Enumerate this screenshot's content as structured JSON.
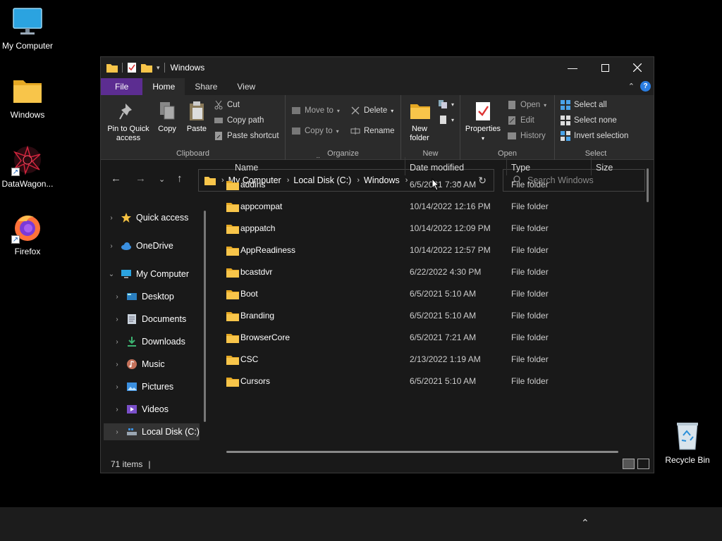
{
  "desktop": {
    "icons": [
      {
        "label": "My Computer",
        "icon": "monitor-icon"
      },
      {
        "label": "Windows",
        "icon": "folder-icon"
      },
      {
        "label": "DataWagon...",
        "icon": "datawagon-app-icon"
      },
      {
        "label": "Firefox",
        "icon": "firefox-icon"
      },
      {
        "label": "Recycle Bin",
        "icon": "recycle-bin-icon"
      }
    ]
  },
  "window": {
    "title": "Windows",
    "tabs": [
      "File",
      "Home",
      "Share",
      "View"
    ],
    "active_tab": "Home"
  },
  "ribbon": {
    "clipboard": {
      "label": "Clipboard",
      "pin": "Pin to Quick\naccess",
      "copy": "Copy",
      "paste": "Paste",
      "cut": "Cut",
      "copy_path": "Copy path",
      "paste_shortcut": "Paste shortcut"
    },
    "organize": {
      "label": "Organize",
      "move_to": "Move to",
      "copy_to": "Copy to",
      "delete": "Delete",
      "rename": "Rename"
    },
    "new": {
      "label": "New",
      "new_folder": "New\nfolder"
    },
    "open": {
      "label": "Open",
      "properties": "Properties",
      "open": "Open",
      "edit": "Edit",
      "history": "History"
    },
    "select": {
      "label": "Select",
      "select_all": "Select all",
      "select_none": "Select none",
      "invert": "Invert selection"
    }
  },
  "address": {
    "crumbs": [
      "My Computer",
      "Local Disk (C:)",
      "Windows"
    ],
    "search_placeholder": "Search Windows"
  },
  "nav": {
    "items": [
      {
        "label": "Quick access",
        "icon": "star-icon"
      },
      {
        "label": "OneDrive",
        "icon": "cloud-icon"
      },
      {
        "label": "My Computer",
        "icon": "monitor-icon"
      },
      {
        "label": "Desktop",
        "icon": "desktop-icon"
      },
      {
        "label": "Documents",
        "icon": "documents-icon"
      },
      {
        "label": "Downloads",
        "icon": "download-icon"
      },
      {
        "label": "Music",
        "icon": "music-icon"
      },
      {
        "label": "Pictures",
        "icon": "pictures-icon"
      },
      {
        "label": "Videos",
        "icon": "videos-icon"
      },
      {
        "label": "Local Disk (C:)",
        "icon": "disk-icon"
      }
    ]
  },
  "files": {
    "columns": [
      "Name",
      "Date modified",
      "Type",
      "Size"
    ],
    "rows": [
      {
        "name": "addins",
        "date": "6/5/2021 7:30 AM",
        "type": "File folder"
      },
      {
        "name": "appcompat",
        "date": "10/14/2022 12:16 PM",
        "type": "File folder"
      },
      {
        "name": "apppatch",
        "date": "10/14/2022 12:09 PM",
        "type": "File folder"
      },
      {
        "name": "AppReadiness",
        "date": "10/14/2022 12:57 PM",
        "type": "File folder"
      },
      {
        "name": "bcastdvr",
        "date": "6/22/2022 4:30 PM",
        "type": "File folder"
      },
      {
        "name": "Boot",
        "date": "6/5/2021 5:10 AM",
        "type": "File folder"
      },
      {
        "name": "Branding",
        "date": "6/5/2021 5:10 AM",
        "type": "File folder"
      },
      {
        "name": "BrowserCore",
        "date": "6/5/2021 7:21 AM",
        "type": "File folder"
      },
      {
        "name": "CSC",
        "date": "2/13/2022 1:19 AM",
        "type": "File folder"
      },
      {
        "name": "Cursors",
        "date": "6/5/2021 5:10 AM",
        "type": "File folder"
      }
    ]
  },
  "status": {
    "items": "71 items"
  },
  "colors": {
    "file_tab": "#5c2d91",
    "folder": "#f8c54a",
    "accent": "#2a7de1"
  }
}
